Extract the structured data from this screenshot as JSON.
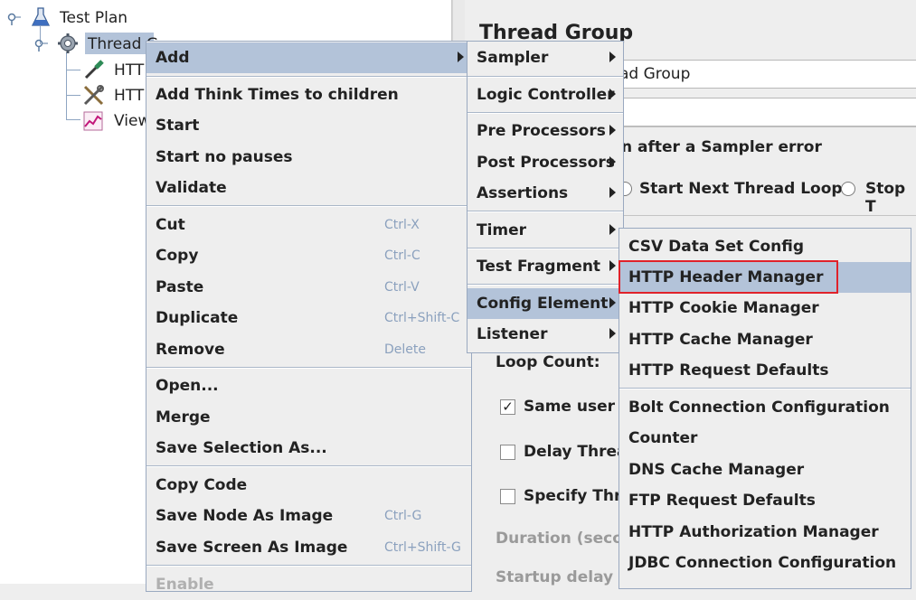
{
  "tree": {
    "items": [
      {
        "label": "Test Plan",
        "icon": "flask-icon"
      },
      {
        "label": "Thread G",
        "icon": "gear-icon"
      },
      {
        "label": "HTT",
        "icon": "dropper-icon"
      },
      {
        "label": "HTT",
        "icon": "tools-icon"
      },
      {
        "label": "View",
        "icon": "graph-icon"
      }
    ]
  },
  "right_panel": {
    "title": "Thread Group",
    "name_value": "ad Group",
    "error_action_legend": "n after a Sampler error",
    "radio_next_loop": "Start Next Thread Loop",
    "radio_stop": "Stop T",
    "loop_count_label": "Loop Count:",
    "same_user_label": "Same user c",
    "delay_thread_label": "Delay Threa",
    "specify_thread_label": "Specify Thre",
    "duration_label": "Duration (secon",
    "startup_delay_label": "Startup delay (s"
  },
  "context_menu": {
    "add": "Add",
    "add_think_times": "Add Think Times to children",
    "start": "Start",
    "start_no_pauses": "Start no pauses",
    "validate": "Validate",
    "cut": "Cut",
    "cut_acc": "Ctrl-X",
    "copy": "Copy",
    "copy_acc": "Ctrl-C",
    "paste": "Paste",
    "paste_acc": "Ctrl-V",
    "duplicate": "Duplicate",
    "duplicate_acc": "Ctrl+Shift-C",
    "remove": "Remove",
    "remove_acc": "Delete",
    "open": "Open...",
    "merge": "Merge",
    "save_selection": "Save Selection As...",
    "copy_code": "Copy Code",
    "save_node_image": "Save Node As Image",
    "save_node_image_acc": "Ctrl-G",
    "save_screen_image": "Save Screen As Image",
    "save_screen_image_acc": "Ctrl+Shift-G",
    "enable": "Enable"
  },
  "add_submenu": {
    "sampler": "Sampler",
    "logic_controller": "Logic Controller",
    "pre_processors": "Pre Processors",
    "post_processors": "Post Processors",
    "assertions": "Assertions",
    "timer": "Timer",
    "test_fragment": "Test Fragment",
    "config_element": "Config Element",
    "listener": "Listener"
  },
  "config_submenu": {
    "csv": "CSV Data Set Config",
    "header_manager": "HTTP Header Manager",
    "cookie_manager": "HTTP Cookie Manager",
    "cache_manager": "HTTP Cache Manager",
    "request_defaults": "HTTP Request Defaults",
    "bolt": "Bolt Connection Configuration",
    "counter": "Counter",
    "dns_cache": "DNS Cache Manager",
    "ftp_defaults": "FTP Request Defaults",
    "auth_manager": "HTTP Authorization Manager",
    "jdbc": "JDBC Connection Configuration"
  },
  "colors": {
    "highlight": "#b3c3d9",
    "red_frame": "#e0222a",
    "menu_bg": "#eeeeee",
    "accelerator": "#8ba1be"
  }
}
